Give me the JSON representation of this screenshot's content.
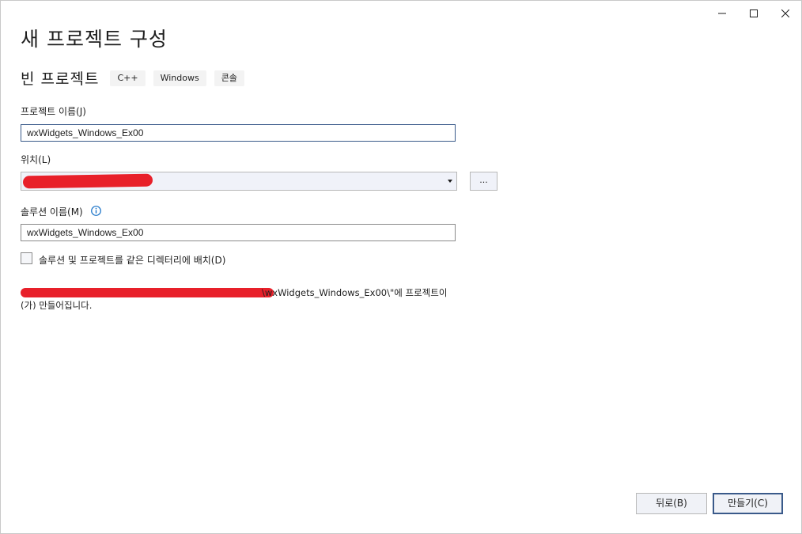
{
  "window": {
    "controls": [
      {
        "name": "minimize-icon"
      },
      {
        "name": "maximize-icon"
      },
      {
        "name": "close-icon"
      }
    ]
  },
  "header": {
    "title": "새 프로젝트 구성"
  },
  "template": {
    "name": "빈 프로젝트",
    "tags": [
      "C++",
      "Windows",
      "콘솔"
    ]
  },
  "form": {
    "project_name_label": "프로젝트 이름(J)",
    "project_name_value": "wxWidgets_Windows_Ex00",
    "location_label": "위치(L)",
    "browse_label": "...",
    "solution_name_label": "솔루션 이름(M)",
    "solution_name_value": "wxWidgets_Windows_Ex00",
    "same_directory_label": "솔루션 및 프로젝트를 같은 디렉터리에 배치(D)",
    "same_directory_checked": false
  },
  "path_info": {
    "line1_tail": "\\wxWidgets_Windows_Ex00\\\"에 프로젝트이",
    "line2": "(가) 만들어집니다."
  },
  "footer": {
    "back_label": "뒤로(B)",
    "create_label": "만들기(C)"
  },
  "colors": {
    "accent": "#3a5a8a",
    "redaction": "#e8202a",
    "info": "#1a73c8"
  }
}
